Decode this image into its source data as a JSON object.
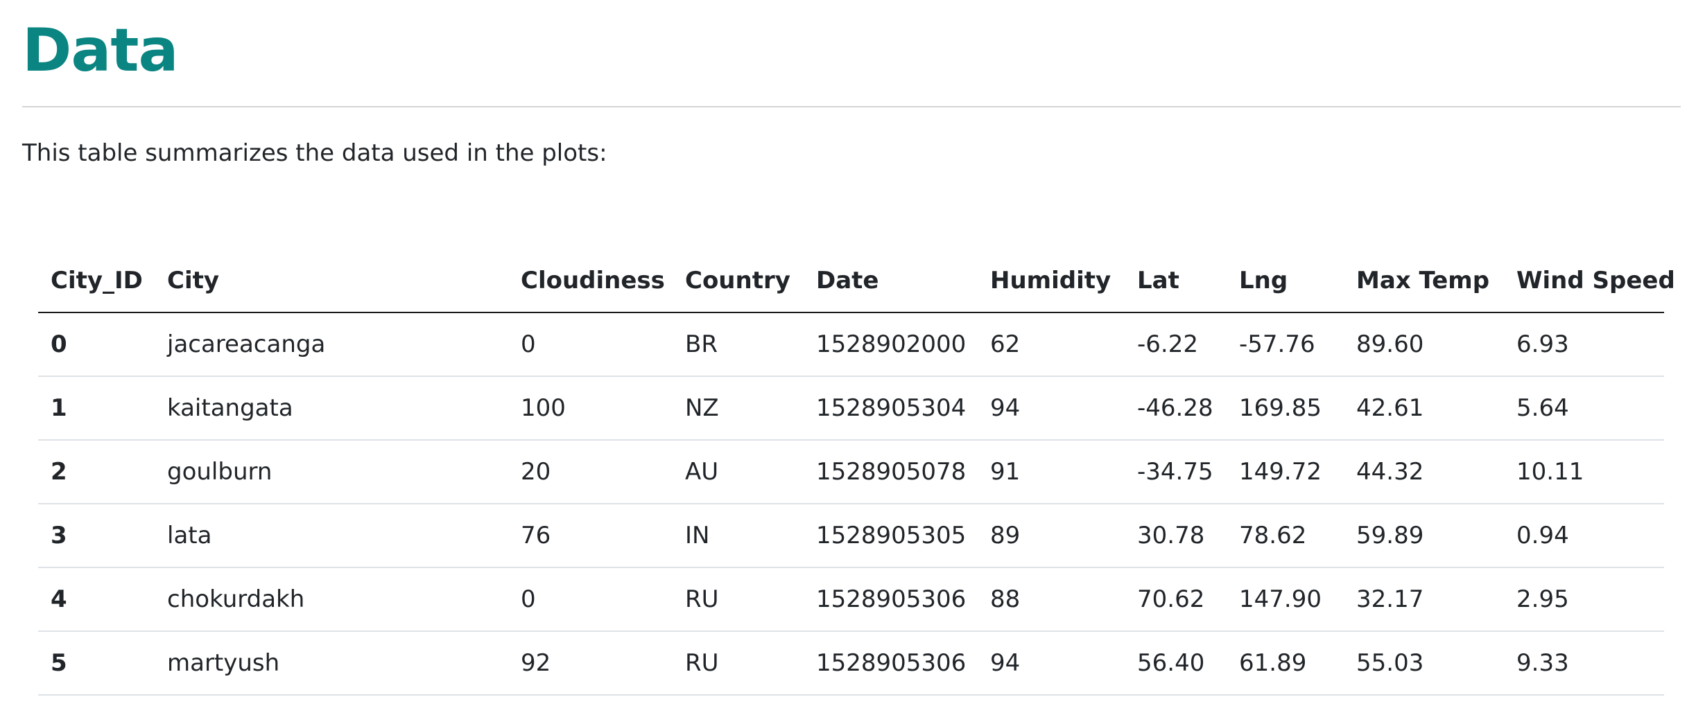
{
  "page": {
    "title": "Data",
    "intro": "This table summarizes the data used in the plots:"
  },
  "table": {
    "columns": [
      "City_ID",
      "City",
      "Cloudiness",
      "Country",
      "Date",
      "Humidity",
      "Lat",
      "Lng",
      "Max Temp",
      "Wind Speed"
    ],
    "rows": [
      [
        "0",
        "jacareacanga",
        "0",
        "BR",
        "1528902000",
        "62",
        "-6.22",
        "-57.76",
        "89.60",
        "6.93"
      ],
      [
        "1",
        "kaitangata",
        "100",
        "NZ",
        "1528905304",
        "94",
        "-46.28",
        "169.85",
        "42.61",
        "5.64"
      ],
      [
        "2",
        "goulburn",
        "20",
        "AU",
        "1528905078",
        "91",
        "-34.75",
        "149.72",
        "44.32",
        "10.11"
      ],
      [
        "3",
        "lata",
        "76",
        "IN",
        "1528905305",
        "89",
        "30.78",
        "78.62",
        "59.89",
        "0.94"
      ],
      [
        "4",
        "chokurdakh",
        "0",
        "RU",
        "1528905306",
        "88",
        "70.62",
        "147.90",
        "32.17",
        "2.95"
      ],
      [
        "5",
        "martyush",
        "92",
        "RU",
        "1528905306",
        "94",
        "56.40",
        "61.89",
        "55.03",
        "9.33"
      ]
    ]
  },
  "colors": {
    "title": "#0a8582",
    "text": "#212529",
    "header_rule": "#1a1a1a",
    "row_rule": "#dee2e6"
  }
}
